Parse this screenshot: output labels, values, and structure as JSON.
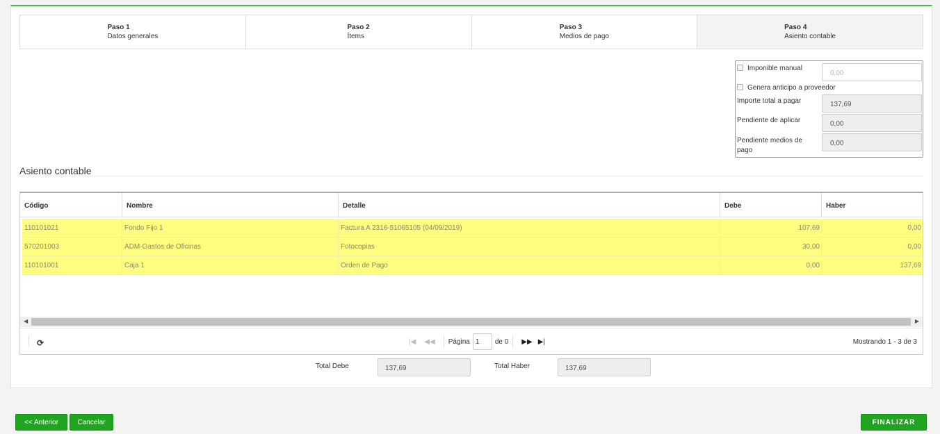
{
  "steps": [
    {
      "num": "Paso 1",
      "label": "Datos generales"
    },
    {
      "num": "Paso 2",
      "label": "Ítems"
    },
    {
      "num": "Paso 3",
      "label": "Medios de pago"
    },
    {
      "num": "Paso 4",
      "label": "Asiento contable"
    }
  ],
  "active_step": 4,
  "summary": {
    "imponible_manual_label": "Imponible manual",
    "imponible_manual_placeholder": "0,00",
    "anticipo_label": "Genera anticipo a proveedor",
    "importe_total_label": "Importe total a pagar",
    "importe_total_value": "137,69",
    "pendiente_aplicar_label": "Pendiente de aplicar",
    "pendiente_aplicar_value": "0,00",
    "pendiente_medios_label_1": "Pendiente medios de",
    "pendiente_medios_label_2": "pago",
    "pendiente_medios_value": "0,00"
  },
  "section_title": "Asiento contable",
  "grid": {
    "columns": [
      "Código",
      "Nombre",
      "Detalle",
      "Debe",
      "Haber"
    ],
    "rows": [
      {
        "codigo": "110101021",
        "nombre": "Fondo Fijo 1",
        "detalle": "Factura A 2316-51065105 (04/09/2019)",
        "debe": "107,69",
        "haber": "0,00"
      },
      {
        "codigo": "570201003",
        "nombre": "ADM-Gastos de Oficinas",
        "detalle": "Fotocopias",
        "debe": "30,00",
        "haber": "0,00"
      },
      {
        "codigo": "110101001",
        "nombre": "Caja 1",
        "detalle": "Orden de Pago",
        "debe": "0,00",
        "haber": "137,69"
      }
    ],
    "row_highlight": "#fdfd80"
  },
  "pager": {
    "page_label": "Página",
    "page_value": "1",
    "of_label": "de 0",
    "info": "Mostrando 1 - 3 de 3"
  },
  "totals": {
    "debe_label": "Total Debe",
    "debe_value": "137,69",
    "haber_label": "Total Haber",
    "haber_value": "137,69"
  },
  "buttons": {
    "anterior": "<< Anterior",
    "cancelar": "Cancelar",
    "finalizar": "FINALIZAR"
  },
  "colors": {
    "accent": "#1fa51f",
    "top_border": "#3ec23e"
  },
  "icons": [
    "refresh-icon",
    "first-page-icon",
    "prev-page-icon",
    "next-page-icon",
    "last-page-icon",
    "scroll-left-icon",
    "scroll-right-icon"
  ]
}
